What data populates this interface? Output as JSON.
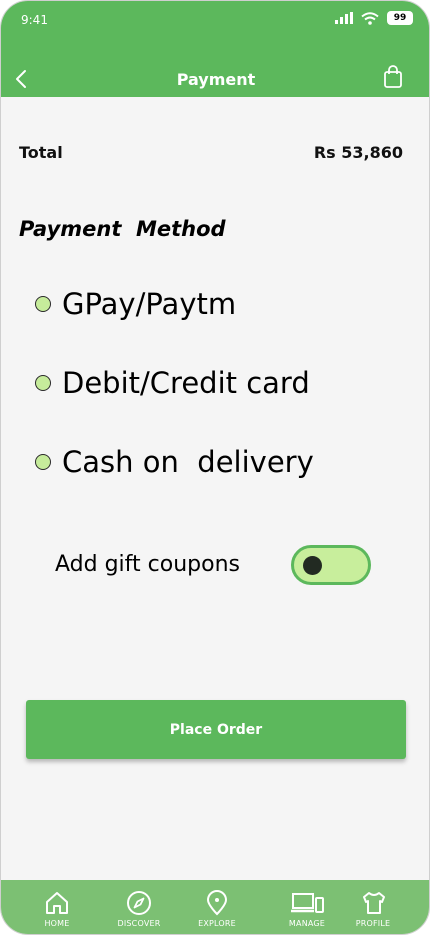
{
  "status_bar": {
    "time": "9:41",
    "battery": "99"
  },
  "header": {
    "title": "Payment",
    "back_icon": "chevron-left-icon",
    "cart_icon": "shopping-bag-icon"
  },
  "total": {
    "label": "Total",
    "amount": "Rs 53,860"
  },
  "payment_method": {
    "title": "Payment  Method",
    "options": [
      {
        "label": "GPay/Paytm"
      },
      {
        "label": "Debit/Credit card"
      },
      {
        "label": "Cash on  delivery"
      }
    ]
  },
  "gift_coupon": {
    "label": "Add gift coupons",
    "enabled": false
  },
  "place_order": {
    "label": "Place Order"
  },
  "bottom_nav": {
    "items": [
      {
        "label": "HOME",
        "icon": "home-icon"
      },
      {
        "label": "DISCOVER",
        "icon": "compass-icon"
      },
      {
        "label": "EXPLORE",
        "icon": "location-pin-icon"
      },
      {
        "label": "MANAGE",
        "icon": "devices-icon"
      },
      {
        "label": "PROFILE",
        "icon": "shirt-icon"
      }
    ]
  },
  "colors": {
    "primary": "#5cb85c",
    "nav": "#7cc073",
    "radio_fill": "#c6ec9b",
    "toggle_fill": "#c8ee9c",
    "background": "#f5f5f5"
  }
}
